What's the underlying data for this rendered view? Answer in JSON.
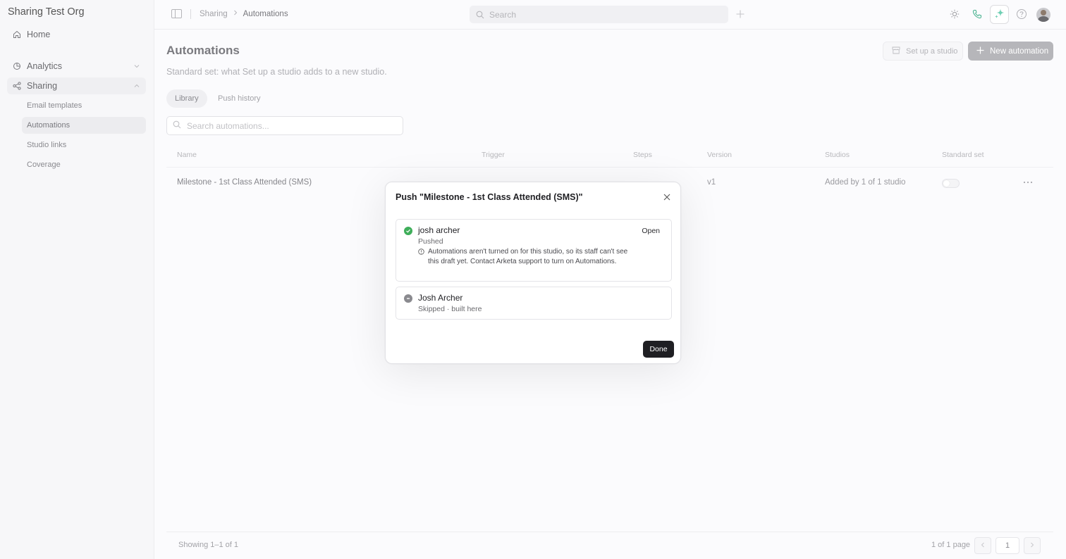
{
  "sidebar": {
    "org_name": "Sharing Test Org",
    "home": "Home",
    "analytics": "Analytics",
    "sharing": "Sharing",
    "sub_items": [
      "Email templates",
      "Automations",
      "Studio links",
      "Coverage"
    ]
  },
  "topbar": {
    "breadcrumb_parent": "Sharing",
    "breadcrumb_current": "Automations",
    "search_placeholder": "Search"
  },
  "page": {
    "title": "Automations",
    "subtitle": "Standard set: what Set up a studio adds to a new studio.",
    "setup_button": "Set up a studio",
    "new_button": "New automation",
    "tabs": [
      "Library",
      "Push history"
    ],
    "search_placeholder": "Search automations..."
  },
  "table": {
    "columns": [
      "Name",
      "Trigger",
      "Steps",
      "Version",
      "Studios",
      "Standard set"
    ],
    "rows": [
      {
        "name": "Milestone - 1st Class Attended (SMS)",
        "version": "v1",
        "studios": "Added by 1 of 1 studio",
        "standard_set": false
      }
    ]
  },
  "footer": {
    "showing": "Showing 1–1 of 1",
    "page_info": "1 of 1 page",
    "current_page": "1"
  },
  "modal": {
    "title": "Push \"Milestone - 1st Class Attended (SMS)\"",
    "results": [
      {
        "name": "josh archer",
        "status": "Pushed",
        "action": "Open",
        "warning": "Automations aren't turned on for this studio, so its staff can't see this draft yet. Contact Arketa support to turn on Automations.",
        "state_color": "#3fae5a"
      },
      {
        "name": "Josh Archer",
        "status": "Skipped · built here",
        "state_color": "#8a8a8f"
      }
    ],
    "done_button": "Done"
  }
}
